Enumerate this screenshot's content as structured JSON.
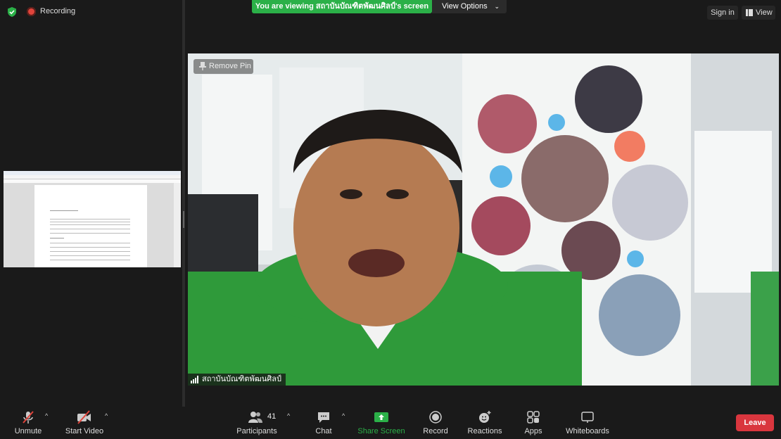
{
  "top": {
    "recording_label": "Recording",
    "viewing_banner": "You are viewing สถาบันบัณฑิตพัฒนศิลป์'s screen",
    "view_options_label": "View Options",
    "sign_in_label": "Sign in",
    "view_label": "View"
  },
  "video": {
    "remove_pin_label": "Remove Pin",
    "participant_name": "สถาบันบัณฑิตพัฒนศิลป์"
  },
  "toolbar": {
    "unmute_label": "Unmute",
    "start_video_label": "Start Video",
    "participants_label": "Participants",
    "participants_count": "41",
    "chat_label": "Chat",
    "share_screen_label": "Share Screen",
    "record_label": "Record",
    "reactions_label": "Reactions",
    "apps_label": "Apps",
    "whiteboards_label": "Whiteboards",
    "leave_label": "Leave"
  },
  "colors": {
    "banner_green": "#2bb048",
    "share_green": "#2bb048",
    "leave_red": "#d9363e",
    "mute_red": "#e0443b"
  }
}
